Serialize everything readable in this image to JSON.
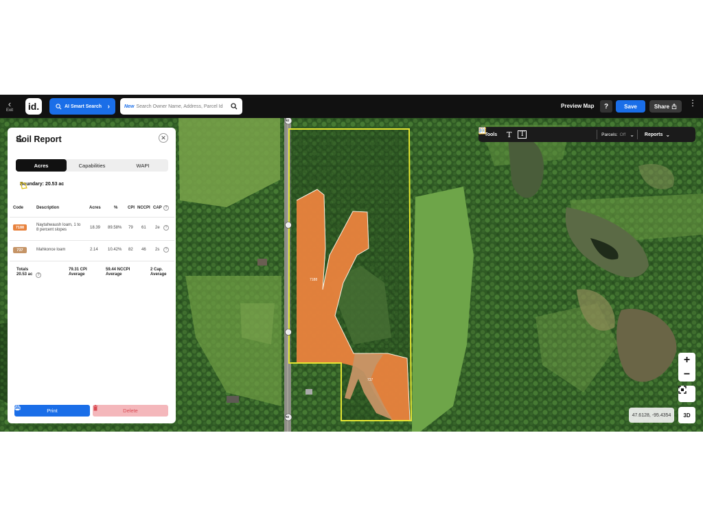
{
  "topbar": {
    "exit_label": "Exit",
    "logo_text": "id.",
    "ai_search_label": "AI Smart Search",
    "search_new_tag": "New",
    "search_placeholder": "Search Owner Name, Address, Parcel Id",
    "preview_label": "Preview Map",
    "help_label": "?",
    "save_label": "Save",
    "share_label": "Share"
  },
  "map_tools": {
    "tools_label": "Tools",
    "parcels_label": "Parcels:",
    "parcels_state": "Off",
    "reports_label": "Reports"
  },
  "map": {
    "road_shield": "92",
    "soil_label_1": "7188",
    "soil_label_2": "737",
    "coords": "47.6128, -95.4354",
    "zoom_in": "+",
    "zoom_out": "−",
    "three_d": "3D",
    "colors": {
      "boundary": "#e6e633",
      "soil_7188": "#e8823d",
      "soil_737": "#c59466",
      "accent": "#1a6ee8"
    }
  },
  "panel": {
    "title": "Soil Report",
    "tabs": [
      "Acres",
      "Capabilities",
      "WAPI"
    ],
    "boundary": "Boundary: 20.53 ac",
    "headers": {
      "code": "Code",
      "description": "Description",
      "acres": "Acres",
      "pct": "%",
      "cpi": "CPI",
      "nccpi": "NCCPI",
      "cap": "CAP"
    },
    "rows": [
      {
        "code": "7188",
        "color": "#e8823d",
        "desc1": "Naytahwaush loam, 1 to",
        "desc2": "8 percent slopes",
        "acres": "18.39",
        "pct": "89.58%",
        "cpi": "79",
        "nccpi": "61",
        "cap": "2e"
      },
      {
        "code": "737",
        "color": "#c59466",
        "desc1": "Mahkonce loam",
        "desc2": "",
        "acres": "2.14",
        "pct": "10.42%",
        "cpi": "82",
        "nccpi": "46",
        "cap": "2s"
      }
    ],
    "totals": {
      "label": "Totals",
      "acres": "20.53 ac",
      "cpi_1": "79.31 CPI",
      "cpi_2": "Average",
      "nccpi_1": "59.44 NCCPI",
      "nccpi_2": "Average",
      "cap_1": "2 Cap.",
      "cap_2": "Average"
    },
    "print_label": "Print",
    "delete_label": "Delete"
  }
}
